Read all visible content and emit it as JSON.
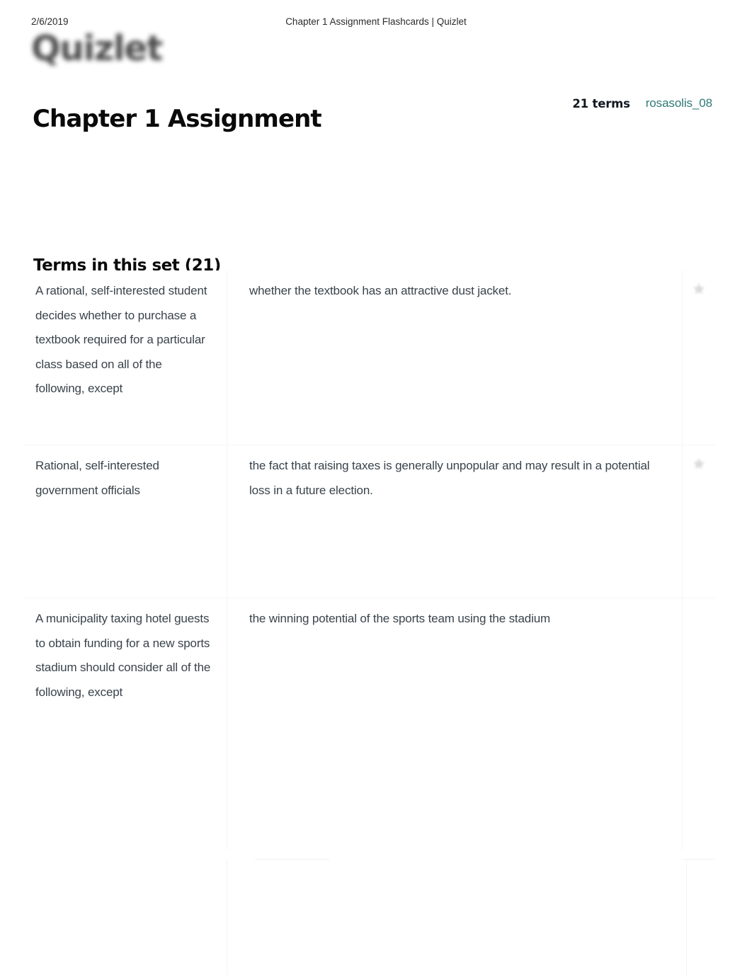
{
  "print_header": {
    "date": "2/6/2019",
    "page_title": "Chapter 1 Assignment Flashcards | Quizlet"
  },
  "brand": {
    "logo_text": "Quizlet",
    "logo_icon": "quizlet-wordmark"
  },
  "set": {
    "title": "Chapter 1 Assignment",
    "terms_count_label": "21 terms",
    "author": "rosasolis_08",
    "accent_color": "#2f7a75"
  },
  "terms_section": {
    "heading": "Terms in this set (21)",
    "star_icon": "star-icon",
    "rows": [
      {
        "term": "A rational, self-interested student decides whether to purchase a textbook required for a particular class based on all of the following, except",
        "definition": "whether the textbook has an attractive dust jacket."
      },
      {
        "term": "Rational, self-interested government officials",
        "definition": "the fact that raising taxes is generally unpopular and may result in a potential loss in a future election."
      },
      {
        "term": "A municipality taxing hotel guests to obtain funding for a new sports stadium should consider all of the following, except",
        "definition": "the winning potential of the sports team using the stadium"
      }
    ]
  }
}
